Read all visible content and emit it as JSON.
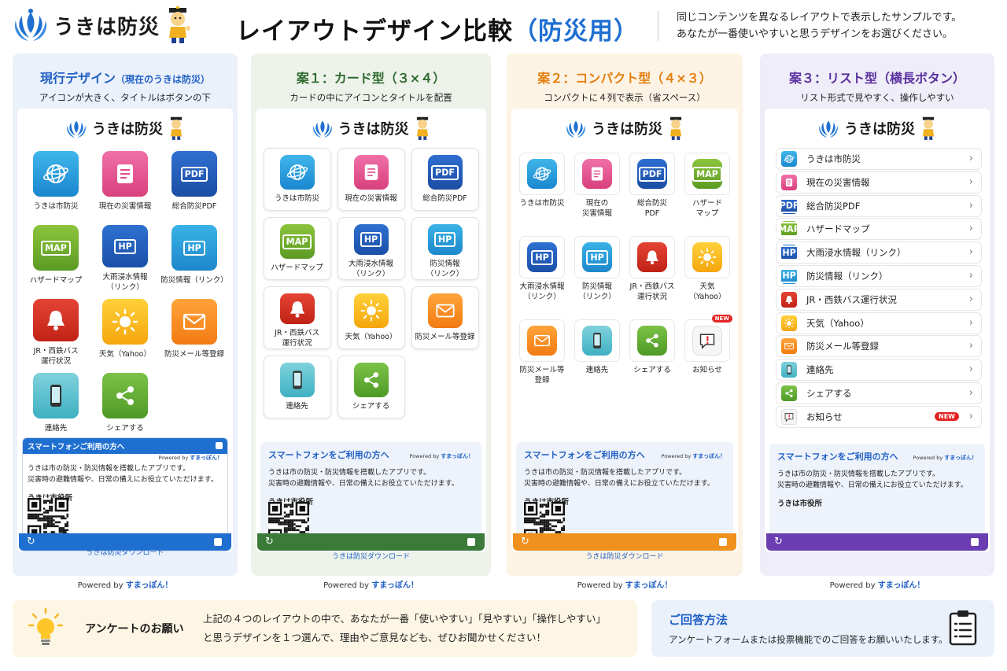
{
  "header": {
    "logo_text": "うきは防災",
    "title_main": "レイアウトデザイン比較",
    "title_accent": "（防災用）",
    "desc_line1": "同じコンテンツを異なるレイアウトで表示したサンプルです。",
    "desc_line2": "あなたが一番使いやすいと思うデザインをお選びください。"
  },
  "app_logo_text": "うきは防災",
  "powered_prefix": "Powered by",
  "powered_brand": "すまっぽん！",
  "panels": [
    {
      "title": "現行デザイン",
      "title_small": "（現在のうきは防災）",
      "subtitle": "アイコンが大きく、タイトルはボタンの下",
      "items": [
        {
          "label": "うきは市防災",
          "icon": "globe-icon"
        },
        {
          "label": "現在の災害情報",
          "icon": "document-icon"
        },
        {
          "label": "総合防災PDF",
          "icon": "pdf-icon"
        },
        {
          "label": "ハザードマップ",
          "icon": "map-icon"
        },
        {
          "label": "大雨浸水情報\n（リンク）",
          "icon": "hp-icon"
        },
        {
          "label": "防災情報（リンク）",
          "icon": "hp-icon"
        },
        {
          "label": "JR・西鉄バス\n運行状況",
          "icon": "bell-icon"
        },
        {
          "label": "天気（Yahoo）",
          "icon": "sun-icon"
        },
        {
          "label": "防災メール等登録",
          "icon": "mail-icon"
        },
        {
          "label": "連絡先",
          "icon": "phone-icon"
        },
        {
          "label": "シェアする",
          "icon": "share-icon"
        }
      ]
    },
    {
      "title": "案１：カード型（３×４）",
      "subtitle": "カードの中にアイコンとタイトルを配置",
      "items": [
        {
          "label": "うきは市防災"
        },
        {
          "label": "現在の災害情報"
        },
        {
          "label": "総合防災PDF"
        },
        {
          "label": "ハザードマップ"
        },
        {
          "label": "大雨浸水情報\n（リンク）"
        },
        {
          "label": "防災情報\n（リンク）"
        },
        {
          "label": "JR・西鉄バス\n運行状況"
        },
        {
          "label": "天気（Yahoo）"
        },
        {
          "label": "防災メール等登録"
        },
        {
          "label": "連絡先"
        },
        {
          "label": "シェアする"
        }
      ]
    },
    {
      "title": "案２：コンパクト型（４×３）",
      "subtitle": "コンパクトに４列で表示（省スペース）",
      "items": [
        {
          "label": "うきは市防災"
        },
        {
          "label": "現在の\n災害情報"
        },
        {
          "label": "総合防災\nPDF"
        },
        {
          "label": "ハザード\nマップ"
        },
        {
          "label": "大雨浸水情報\n（リンク）"
        },
        {
          "label": "防災情報\n（リンク）"
        },
        {
          "label": "JR・西鉄バス\n運行状況"
        },
        {
          "label": "天気\n（Yahoo）"
        },
        {
          "label": "防災メール等\n登録"
        },
        {
          "label": "連絡先"
        },
        {
          "label": "シェアする"
        },
        {
          "label": "お知らせ"
        }
      ]
    },
    {
      "title": "案３：リスト型（横長ボタン）",
      "subtitle": "リスト形式で見やすく、操作しやすい",
      "items": [
        {
          "label": "うきは市防災"
        },
        {
          "label": "現在の災害情報"
        },
        {
          "label": "総合防災PDF"
        },
        {
          "label": "ハザードマップ"
        },
        {
          "label": "大雨浸水情報（リンク）"
        },
        {
          "label": "防災情報（リンク）"
        },
        {
          "label": "JR・西鉄バス運行状況"
        },
        {
          "label": "天気（Yahoo）"
        },
        {
          "label": "防災メール等登録"
        },
        {
          "label": "連絡先"
        },
        {
          "label": "シェアする"
        },
        {
          "label": "お知らせ"
        }
      ]
    }
  ],
  "badge_new": "NEW",
  "icon_text": {
    "pdf": "PDF",
    "map": "MAP",
    "hp": "HP"
  },
  "smartphone": {
    "title": "スマートフォンをご利用の方へ",
    "title_p0": "スマートフォンご利用の方へ",
    "powered_by": "Powered by",
    "brand": "すまっぽん！",
    "line1": "うきは市の防災・防災情報を搭載したアプリです。",
    "line2": "災害時の避難情報や、日常の備えにお役立ていただけます。",
    "city": "うきは市役所",
    "download": "うきは防災ダウンロード"
  },
  "survey": {
    "title": "アンケートのお願い",
    "line1": "上記の４つのレイアウトの中で、あなたが一番「使いやすい」「見やすい」「操作しやすい」",
    "line2": "と思うデザインを１つ選んで、理由やご意見なども、ぜひお聞かせください！"
  },
  "answer": {
    "title": "ご回答方法",
    "text": "アンケートフォームまたは投票機能でのご回答をお願いいたします。"
  }
}
